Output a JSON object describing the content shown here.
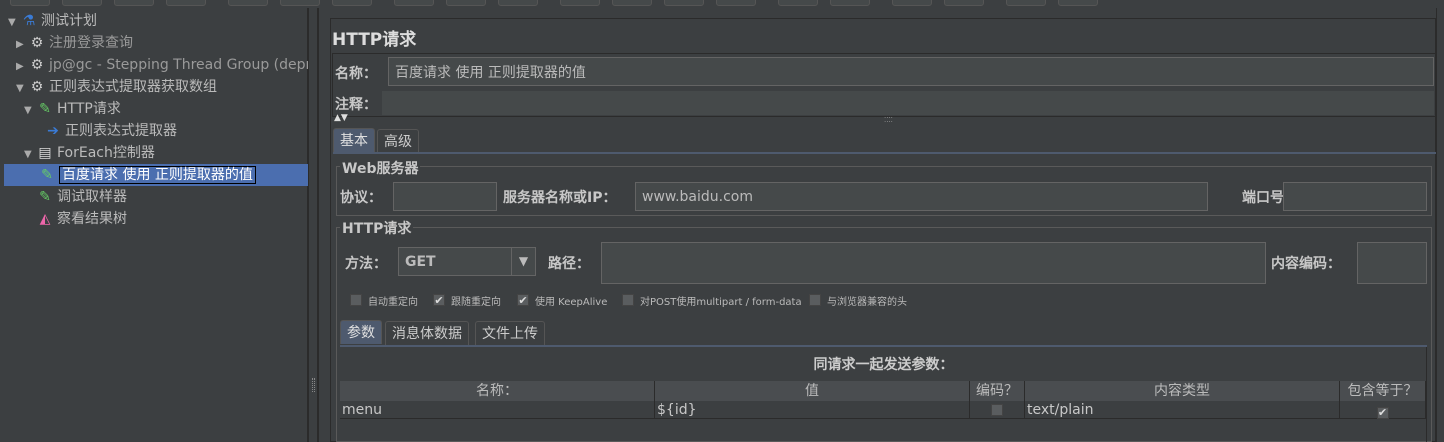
{
  "tree": [
    {
      "label": "测试计划",
      "icon": "flask-icon",
      "expanded": true
    },
    {
      "label": "注册登录查询",
      "icon": "gear-icon",
      "expanded": false,
      "disabled": true
    },
    {
      "label": "jp@gc - Stepping Thread Group (deprec",
      "icon": "gear-icon",
      "expanded": false,
      "disabled": true
    },
    {
      "label": "正则表达式提取器获取数组",
      "icon": "gear-icon",
      "expanded": true
    },
    {
      "label": "HTTP请求",
      "icon": "pipette-icon",
      "expanded": true
    },
    {
      "label": "正则表达式提取器",
      "icon": "extractor-icon"
    },
    {
      "label": "ForEach控制器",
      "icon": "controller-icon",
      "expanded": true
    },
    {
      "label": "百度请求 使用 正则提取器的值",
      "icon": "pipette-icon",
      "selected": true
    },
    {
      "label": "调试取样器",
      "icon": "pipette-icon"
    },
    {
      "label": "察看结果树",
      "icon": "chart-icon"
    }
  ],
  "main": {
    "title": "HTTP请求",
    "name_label": "名称：",
    "name_value": "百度请求 使用 正则提取器的值",
    "comment_label": "注释：",
    "comment_value": "",
    "tabs": [
      "基本",
      "高级"
    ],
    "web_server": {
      "legend": "Web服务器",
      "protocol_label": "协议：",
      "protocol_value": "",
      "server_label": "服务器名称或IP：",
      "server_value": "www.baidu.com",
      "port_label": "端口号：",
      "port_value": ""
    },
    "http": {
      "legend": "HTTP请求",
      "method_label": "方法：",
      "method_value": "GET",
      "path_label": "路径：",
      "path_value": "",
      "encoding_label": "内容编码：",
      "encoding_value": ""
    },
    "checkboxes": [
      {
        "label": "自动重定向",
        "checked": false
      },
      {
        "label": "跟随重定向",
        "checked": true
      },
      {
        "label": "使用 KeepAlive",
        "checked": true
      },
      {
        "label": "对POST使用multipart / form-data",
        "checked": false
      },
      {
        "label": "与浏览器兼容的头",
        "checked": false
      }
    ],
    "subtabs": [
      "参数",
      "消息体数据",
      "文件上传"
    ],
    "table_title": "同请求一起发送参数：",
    "columns": [
      "名称：",
      "值",
      "编码？",
      "内容类型",
      "包含等于？"
    ],
    "rows": [
      {
        "name": "menu",
        "value": "${id}",
        "encode": false,
        "content_type": "text/plain",
        "include_equals": true
      }
    ]
  }
}
